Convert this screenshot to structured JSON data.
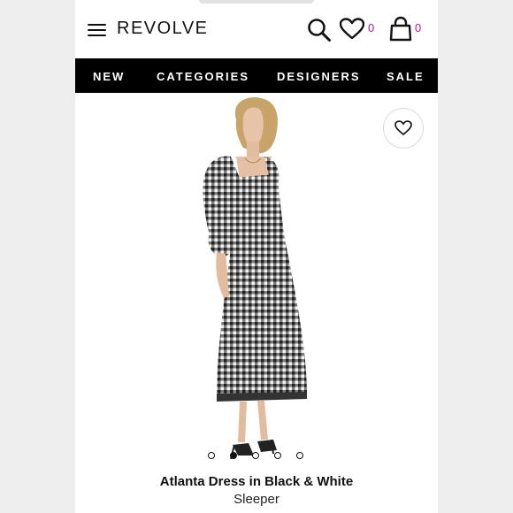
{
  "header": {
    "logo": "REVOLVE",
    "wishlist_count": "0",
    "bag_count": "0"
  },
  "nav": {
    "items": [
      "NEW",
      "CATEGORIES",
      "DESIGNERS",
      "SALE"
    ]
  },
  "gallery": {
    "image_subject": "model wearing black and white gingham dress",
    "current_index": 1,
    "total": 5
  },
  "product": {
    "name": "Atlanta Dress in Black & White",
    "brand": "Sleeper"
  },
  "colors": {
    "accent": "#b5169a",
    "nav_bg": "#000000"
  },
  "icons": [
    "menu-icon",
    "search-icon",
    "heart-icon",
    "bag-icon",
    "wishlist-heart-icon"
  ]
}
